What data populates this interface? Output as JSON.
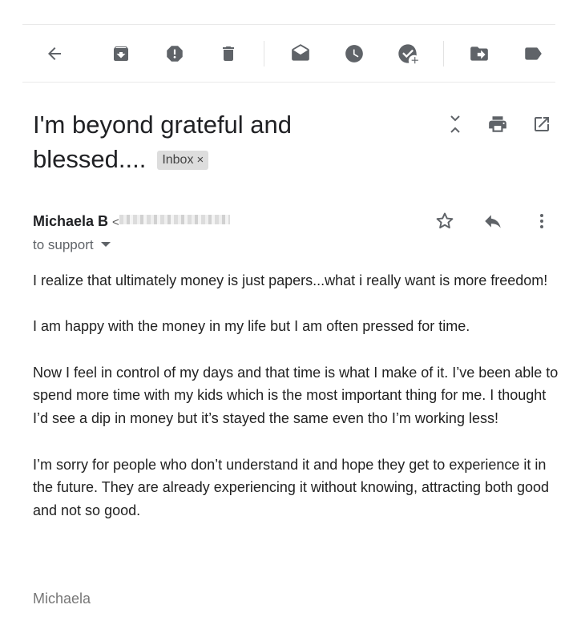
{
  "toolbar": {
    "buttons": [
      {
        "name": "back",
        "icon": "arrow-left-icon"
      },
      {
        "name": "archive",
        "icon": "archive-icon"
      },
      {
        "name": "report-spam",
        "icon": "report-spam-icon"
      },
      {
        "name": "delete",
        "icon": "trash-icon"
      },
      {
        "name": "mark-unread",
        "icon": "mark-unread-icon"
      },
      {
        "name": "snooze",
        "icon": "clock-icon"
      },
      {
        "name": "add-to-tasks",
        "icon": "add-task-icon"
      },
      {
        "name": "move-to",
        "icon": "move-to-icon"
      },
      {
        "name": "labels",
        "icon": "label-icon"
      }
    ],
    "icon_color": "#5f6368"
  },
  "message": {
    "subject": "I'm beyond grateful and blessed....",
    "label_chip": "Inbox",
    "label_chip_close": "×",
    "header_icons": [
      "expand-collapse-icon",
      "print-icon",
      "open-in-new-window-icon"
    ],
    "sender_name": "Michaela B",
    "sender_open_bracket": "<",
    "recipient": "to support",
    "action_icons": [
      "star-icon",
      "reply-icon",
      "more-vertical-icon"
    ],
    "body_paragraphs": [
      "I realize that ultimately money is just papers...what i really want is more freedom!",
      "I am happy with the money in my life but I am often pressed for time.",
      "Now I feel in control of my days and that time is what I make of it. I’ve been able to spend more time with my kids which is the most important thing for me. I thought I’d see a dip in money but it’s stayed the same even tho I’m working less!",
      "I’m sorry for people who don’t understand it and hope they get to experience it in the future. They are already experiencing it without knowing, attracting both good and not so good."
    ],
    "signature": "Michaela"
  }
}
